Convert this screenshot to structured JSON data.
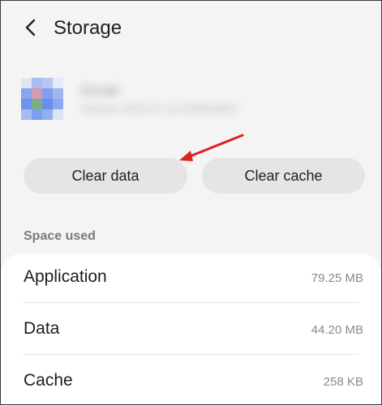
{
  "header": {
    "title": "Storage"
  },
  "app": {
    "name": "Gmail",
    "subtitle": "Version 2020.07.19.325054567"
  },
  "actions": {
    "clear_data_label": "Clear data",
    "clear_cache_label": "Clear cache"
  },
  "space_used": {
    "section_label": "Space used",
    "rows": [
      {
        "label": "Application",
        "value": "79.25 MB"
      },
      {
        "label": "Data",
        "value": "44.20 MB"
      },
      {
        "label": "Cache",
        "value": "258 KB"
      }
    ]
  },
  "colors": {
    "background": "#f4f4f4",
    "button_bg": "#e5e5e5",
    "card_bg": "#ffffff",
    "annotation_arrow": "#e0201d"
  },
  "icons": {
    "back": "chevron-left-icon",
    "app": "app-icon",
    "annotation": "red-arrow-icon"
  }
}
